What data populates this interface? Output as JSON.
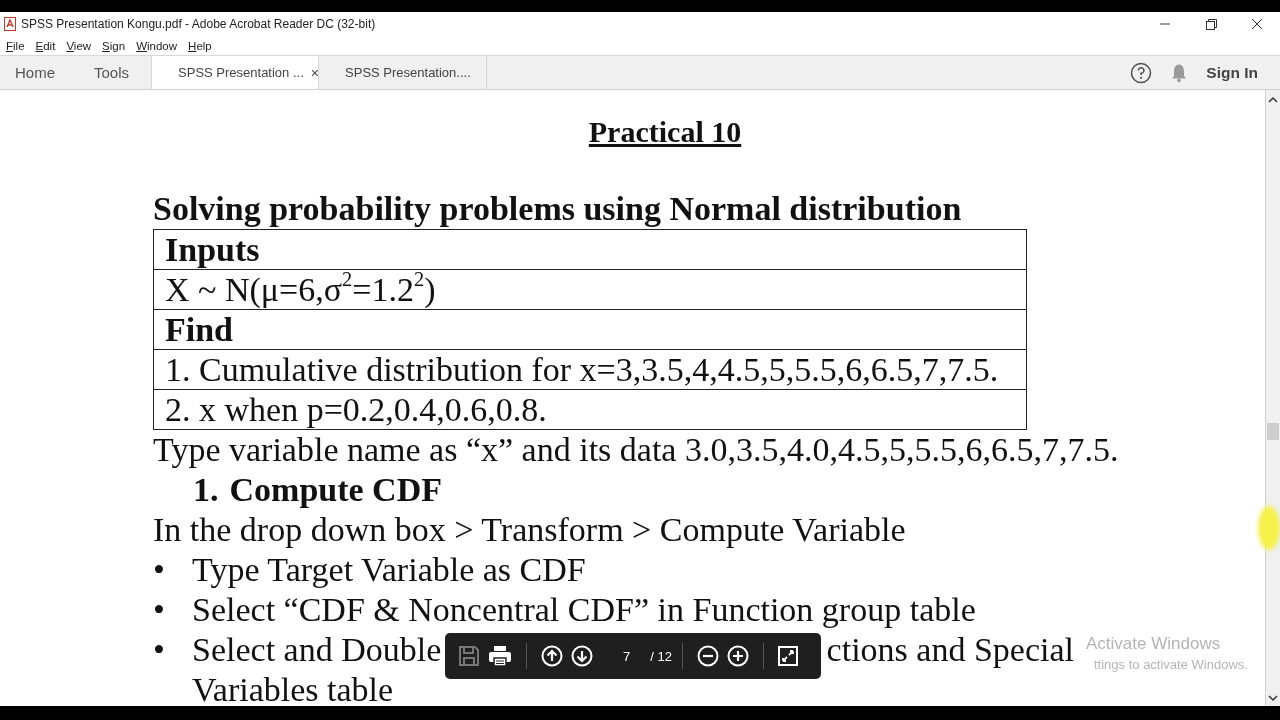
{
  "window": {
    "title": "SPSS Presentation Kongu.pdf - Adobe Acrobat Reader DC (32-bit)"
  },
  "menu": [
    "File",
    "Edit",
    "View",
    "Sign",
    "Window",
    "Help"
  ],
  "nav_tabs": [
    "Home",
    "Tools"
  ],
  "doc_tabs": [
    {
      "label": "SPSS Presentation ...",
      "selected": true,
      "close": "×"
    },
    {
      "label": "SPSS Presentation....",
      "selected": false
    }
  ],
  "sign_in": "Sign In",
  "document": {
    "heading": "Practical 10",
    "subtitle": "Solving probability problems using Normal distribution",
    "table": [
      {
        "kind": "header",
        "text": "Inputs"
      },
      {
        "kind": "body",
        "text": "X ~ N(μ=6,σ$^{2}$=1.2$^{2}$)"
      },
      {
        "kind": "header",
        "text": "Find"
      },
      {
        "kind": "body",
        "text": "1. Cumulative distribution for x=3,3.5,4,4.5,5,5.5,6,6.5,7,7.5."
      },
      {
        "kind": "body",
        "text": "2. x when p=0.2,0.4,0.6,0.8."
      }
    ],
    "blocks": [
      {
        "kind": "para",
        "text": "Type variable name as “x” and its data 3.0,3.5,4.0,4.5,5,5.5,6,6.5,7,7.5."
      },
      {
        "kind": "numbered",
        "marker": "1.",
        "text": "Compute CDF"
      },
      {
        "kind": "para",
        "text": "In the drop down box > Transform > Compute Variable"
      },
      {
        "kind": "bullet",
        "marker": "•",
        "text": "Type Target Variable as CDF"
      },
      {
        "kind": "bullet",
        "marker": "•",
        "text": "Select “CDF & Noncentral CDF” in Function group table"
      },
      {
        "kind": "covered",
        "marker": "•",
        "text": "Select and Double",
        "text_after": "ctions and Special"
      },
      {
        "kind": "continuation",
        "text": "Variables table"
      }
    ]
  },
  "page_toolbar": {
    "save_disabled": true,
    "page": "7",
    "total": "/ 12"
  },
  "activation": {
    "title": "Activate Windows",
    "subtitle": "ttings to activate Windows."
  }
}
